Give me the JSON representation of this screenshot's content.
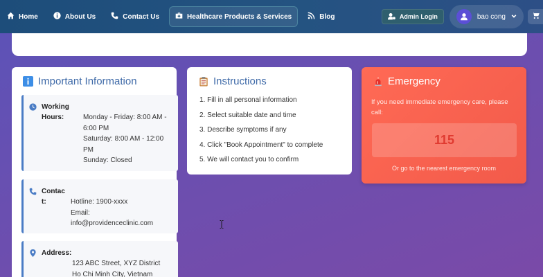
{
  "nav": {
    "home": "Home",
    "about": "About Us",
    "contact": "Contact Us",
    "products": "Healthcare Products & Services",
    "blog": "Blog",
    "admin_login": "Admin Login",
    "username": "bao cong"
  },
  "info": {
    "title": "Important Information",
    "hours_label": "Working Hours:",
    "hours_lines": [
      "Monday - Friday: 8:00 AM - 6:00 PM",
      "Saturday: 8:00 AM - 12:00 PM",
      "Sunday: Closed"
    ],
    "contact_label": "Contact:",
    "contact_lines": [
      "Hotline: 1900-xxxx",
      "Email: info@providenceclinic.com"
    ],
    "address_label": "Address:",
    "address_lines": [
      "123 ABC Street, XYZ District",
      "Ho Chi Minh City, Vietnam"
    ]
  },
  "instructions": {
    "title": "Instructions",
    "steps": [
      "1. Fill in all personal information",
      "2. Select suitable date and time",
      "3. Describe symptoms if any",
      "4. Click \"Book Appointment\" to complete",
      "5. We will contact you to confirm"
    ]
  },
  "emergency": {
    "title": "Emergency",
    "text": "If you need immediate emergency care, please call:",
    "number": "115",
    "footer": "Or go to the nearest emergency room"
  },
  "colors": {
    "accent": "#3f6aa8",
    "emergency": "#f25a4a",
    "nav": "#245381"
  }
}
